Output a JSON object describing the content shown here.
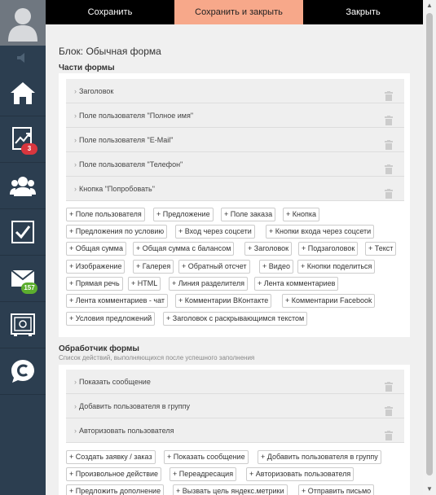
{
  "toolbar": {
    "save_label": "Сохранить",
    "save_close_label": "Сохранить и закрыть",
    "close_label": "Закрыть"
  },
  "sidebar": {
    "mail_badge": "157",
    "stats_badge": "3",
    "colors": {
      "bg": "#2c3e50",
      "badge_red": "#d9363e",
      "badge_green": "#5cae2e"
    }
  },
  "block_title": "Блок: Обычная форма",
  "form_parts": {
    "title": "Части формы",
    "items": [
      "Заголовок",
      "Поле пользователя \"Полное имя\"",
      "Поле пользователя \"E-Mail\"",
      "Поле пользователя \"Телефон\"",
      "Кнопка \"Попробовать\""
    ],
    "add_buttons": [
      "+ Поле пользователя",
      "+ Предложение",
      "+ Поле заказа",
      "+ Кнопка",
      "+ Предложения по условию",
      "+ Вход через соцсети",
      "+ Кнопки входа через соцсети",
      "+ Общая сумма",
      "+ Общая сумма с балансом",
      "+ Заголовок",
      "+ Подзаголовок",
      "+ Текст",
      "+ Изображение",
      "+ Галерея",
      "+ Обратный отсчет",
      "+ Видео",
      "+ Кнопки поделиться",
      "+ Прямая речь",
      "+ HTML",
      "+ Линия разделителя",
      "+ Лента комментариев",
      "+ Лента комментариев - чат",
      "+ Комментарии ВКонтакте",
      "+ Комментарии Facebook",
      "+ Условия предложений",
      "+ Заголовок с раскрывающимся текстом"
    ]
  },
  "form_handler": {
    "title": "Обработчик формы",
    "subtitle": "Список действий, выполняющихся после успешного заполнения",
    "items": [
      "Показать сообщение",
      "Добавить пользователя в группу",
      "Авторизовать пользователя"
    ],
    "add_buttons": [
      "+ Создать заявку / заказ",
      "+ Показать сообщение",
      "+ Добавить пользователя в группу",
      "+ Произвольное действие",
      "+ Переадресация",
      "+ Авторизовать пользователя",
      "+ Предложить дополнение",
      "+ Вызвать цель яндекс.метрики",
      "+ Отправить письмо"
    ]
  }
}
